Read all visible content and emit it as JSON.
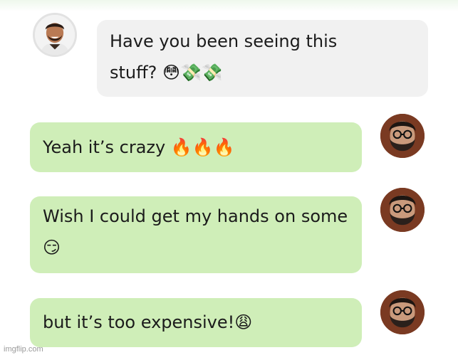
{
  "conversation": {
    "messages": [
      {
        "direction": "incoming",
        "avatar": "smiling-man-avatar",
        "lines": [
          "Have you been seeing this",
          "stuff? 😳💸💸"
        ]
      },
      {
        "direction": "outgoing",
        "avatar": "bearded-man-glasses-avatar",
        "lines": [
          "Yeah it’s crazy 🔥🔥🔥"
        ]
      },
      {
        "direction": "outgoing",
        "avatar": "bearded-man-glasses-avatar",
        "lines": [
          "Wish I could get my hands on some",
          "😏"
        ]
      },
      {
        "direction": "outgoing",
        "avatar": "bearded-man-glasses-avatar",
        "lines": [
          "but it’s too expensive!😩"
        ]
      }
    ]
  },
  "watermark": "imgflip.com",
  "colors": {
    "incoming_bubble": "#f1f1f1",
    "outgoing_bubble": "#cfeeb8",
    "text": "#1b1b1b"
  }
}
